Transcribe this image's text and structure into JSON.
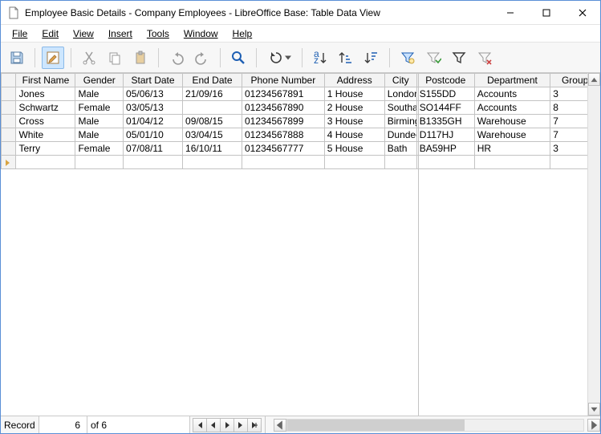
{
  "titlebar": {
    "title": "Employee Basic Details - Company Employees - LibreOffice Base: Table Data View"
  },
  "menu": {
    "file": "File",
    "edit": "Edit",
    "view": "View",
    "insert": "Insert",
    "tools": "Tools",
    "window": "Window",
    "help": "Help"
  },
  "columns": {
    "first_name": "First Name",
    "gender": "Gender",
    "start_date": "Start Date",
    "end_date": "End Date",
    "phone": "Phone Number",
    "address": "Address",
    "city": "City",
    "postcode": "Postcode",
    "department": "Department",
    "group": "Group"
  },
  "rows": [
    {
      "first_name": "Jones",
      "gender": "Male",
      "start_date": "05/06/13",
      "end_date": "21/09/16",
      "phone": "01234567891",
      "address": "1 House",
      "city": "London",
      "postcode": "S155DD",
      "department": "Accounts",
      "group": "3"
    },
    {
      "first_name": "Schwartz",
      "gender": "Female",
      "start_date": "03/05/13",
      "end_date": "",
      "phone": "01234567890",
      "address": "2 House",
      "city": "Southampton",
      "postcode": "SO144FF",
      "department": "Accounts",
      "group": "8"
    },
    {
      "first_name": "Cross",
      "gender": "Male",
      "start_date": "01/04/12",
      "end_date": "09/08/15",
      "phone": "01234567899",
      "address": "3 House",
      "city": "Birmingham",
      "postcode": "B1335GH",
      "department": "Warehouse",
      "group": "7"
    },
    {
      "first_name": "White",
      "gender": "Male",
      "start_date": "05/01/10",
      "end_date": "03/04/15",
      "phone": "01234567888",
      "address": "4 House",
      "city": "Dundee",
      "postcode": "D117HJ",
      "department": "Warehouse",
      "group": "7"
    },
    {
      "first_name": "Terry",
      "gender": "Female",
      "start_date": "07/08/11",
      "end_date": "16/10/11",
      "phone": "01234567777",
      "address": "5 House",
      "city": "Bath",
      "postcode": "BA59HP",
      "department": "HR",
      "group": "3"
    }
  ],
  "record_nav": {
    "label": "Record",
    "current": "6",
    "of_label": "of",
    "total": "6"
  }
}
